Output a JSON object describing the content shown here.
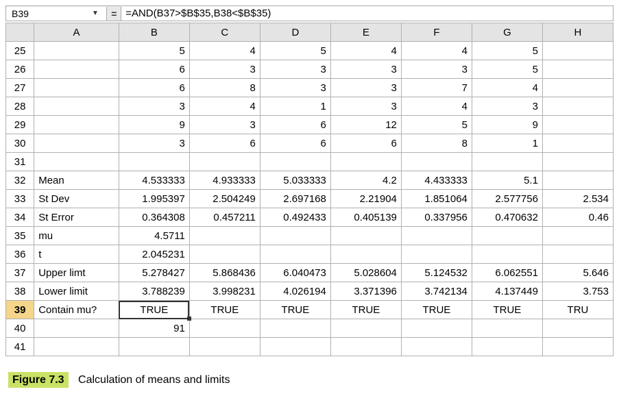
{
  "nameBox": "B39",
  "formulaBar": "=AND(B37>$B$35,B38<$B$35)",
  "fxSymbol": "=",
  "columns": [
    "A",
    "B",
    "C",
    "D",
    "E",
    "F",
    "G",
    "H"
  ],
  "rows": [
    {
      "n": 25,
      "A": "",
      "cells": [
        "5",
        "4",
        "5",
        "4",
        "4",
        "5",
        ""
      ]
    },
    {
      "n": 26,
      "A": "",
      "cells": [
        "6",
        "3",
        "3",
        "3",
        "3",
        "5",
        ""
      ]
    },
    {
      "n": 27,
      "A": "",
      "cells": [
        "6",
        "8",
        "3",
        "3",
        "7",
        "4",
        ""
      ]
    },
    {
      "n": 28,
      "A": "",
      "cells": [
        "3",
        "4",
        "1",
        "3",
        "4",
        "3",
        ""
      ]
    },
    {
      "n": 29,
      "A": "",
      "cells": [
        "9",
        "3",
        "6",
        "12",
        "5",
        "9",
        ""
      ]
    },
    {
      "n": 30,
      "A": "",
      "cells": [
        "3",
        "6",
        "6",
        "6",
        "8",
        "1",
        ""
      ]
    },
    {
      "n": 31,
      "A": "",
      "cells": [
        "",
        "",
        "",
        "",
        "",
        "",
        ""
      ]
    },
    {
      "n": 32,
      "A": "Mean",
      "cells": [
        "4.533333",
        "4.933333",
        "5.033333",
        "4.2",
        "4.433333",
        "5.1",
        ""
      ]
    },
    {
      "n": 33,
      "A": "St Dev",
      "cells": [
        "1.995397",
        "2.504249",
        "2.697168",
        "2.21904",
        "1.851064",
        "2.577756",
        "2.534"
      ]
    },
    {
      "n": 34,
      "A": "St Error",
      "cells": [
        "0.364308",
        "0.457211",
        "0.492433",
        "0.405139",
        "0.337956",
        "0.470632",
        "0.46"
      ]
    },
    {
      "n": 35,
      "A": "mu",
      "cells": [
        "4.5711",
        "",
        "",
        "",
        "",
        "",
        ""
      ]
    },
    {
      "n": 36,
      "A": "t",
      "cells": [
        "2.045231",
        "",
        "",
        "",
        "",
        "",
        ""
      ]
    },
    {
      "n": 37,
      "A": "Upper limt",
      "cells": [
        "5.278427",
        "5.868436",
        "6.040473",
        "5.028604",
        "5.124532",
        "6.062551",
        "5.646"
      ]
    },
    {
      "n": 38,
      "A": "Lower limit",
      "cells": [
        "3.788239",
        "3.998231",
        "4.026194",
        "3.371396",
        "3.742134",
        "4.137449",
        "3.753"
      ]
    },
    {
      "n": 39,
      "A": "Contain mu?",
      "cells": [
        "TRUE",
        "TRUE",
        "TRUE",
        "TRUE",
        "TRUE",
        "TRUE",
        "TRU"
      ],
      "sel": "B"
    },
    {
      "n": 40,
      "A": "",
      "cells": [
        "91",
        "",
        "",
        "",
        "",
        "",
        ""
      ]
    },
    {
      "n": 41,
      "A": "",
      "cells": [
        "",
        "",
        "",
        "",
        "",
        "",
        ""
      ]
    }
  ],
  "caption": {
    "label": "Figure 7.3",
    "text": "Calculation of means and limits"
  }
}
